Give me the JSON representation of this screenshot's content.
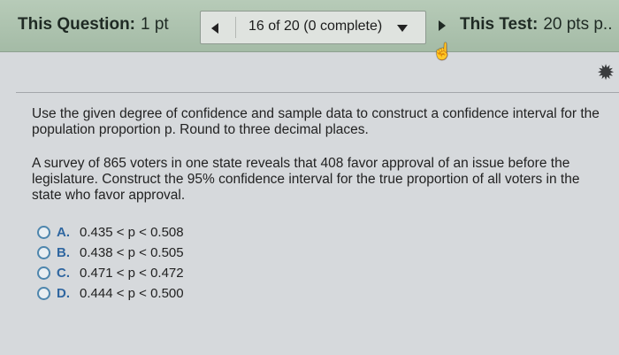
{
  "header": {
    "question_label": "This Question:",
    "question_points": "1 pt",
    "progress": "16 of 20 (0 complete)",
    "test_label": "This Test:",
    "test_points": "20 pts p.."
  },
  "question": {
    "instructions": "Use the given degree of confidence and sample data to construct a confidence interval for the population proportion p. Round to three decimal places.",
    "problem": "A survey of 865 voters in one state reveals that 408 favor approval of an issue before the legislature. Construct the 95% confidence interval for the true proportion of all voters in the state who favor approval.",
    "options": [
      {
        "letter": "A.",
        "text": "0.435 < p < 0.508"
      },
      {
        "letter": "B.",
        "text": "0.438 < p < 0.505"
      },
      {
        "letter": "C.",
        "text": "0.471 < p < 0.472"
      },
      {
        "letter": "D.",
        "text": "0.444 < p < 0.500"
      }
    ]
  },
  "icons": {
    "prev": "triangle-left-icon",
    "dropdown": "triangle-down-icon",
    "next": "triangle-right-icon",
    "settings": "gear-icon",
    "cursor": "hand-pointer-icon"
  },
  "colors": {
    "header_bg": "#a9bfaa",
    "option_letter": "#2f66a0",
    "radio_border": "#4e86ad"
  }
}
